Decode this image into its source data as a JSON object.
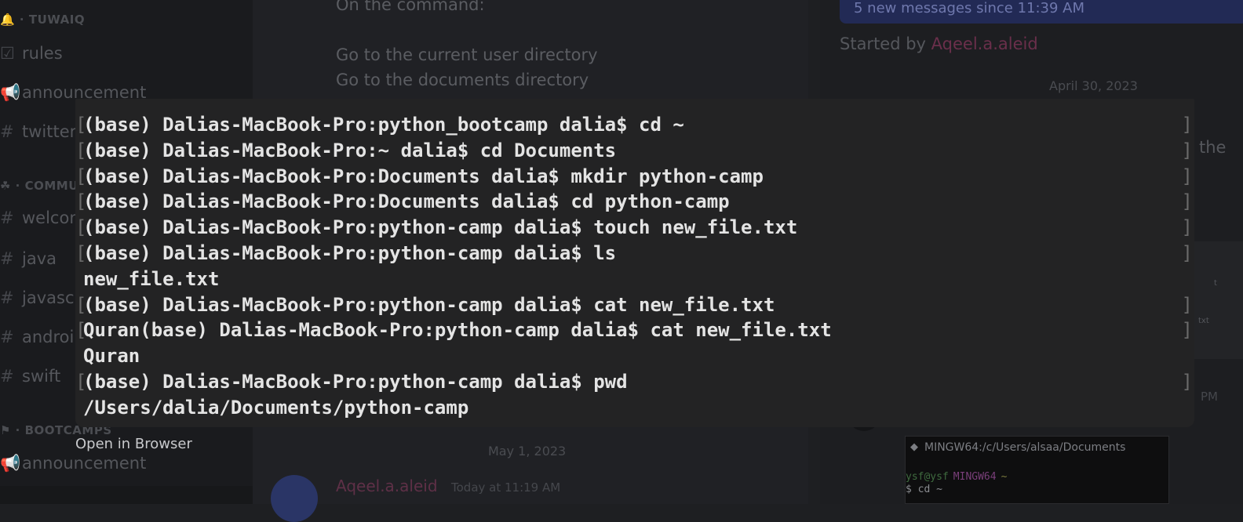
{
  "sidebar": {
    "categories": [
      {
        "label": "TUWAIQ"
      },
      {
        "label": "COMMU"
      },
      {
        "label": "BOOTCAMPS"
      }
    ],
    "items": [
      {
        "label": "rules"
      },
      {
        "label": "announcement"
      },
      {
        "label": "twitter"
      },
      {
        "label": "welcom"
      },
      {
        "label": "java"
      },
      {
        "label": "javascr"
      },
      {
        "label": "androi"
      },
      {
        "label": "swift"
      },
      {
        "label": "announcement"
      }
    ]
  },
  "chat": {
    "lines": [
      "On the command:",
      "Go to the current user directory",
      "Go to the documents directory"
    ],
    "date_separator": "May 1, 2023",
    "message": {
      "author": "Aqeel.a.aleid",
      "timestamp": "Today at 11:19 AM"
    }
  },
  "thread": {
    "new_messages_banner": "5 new messages since 11:39 AM",
    "started_by_prefix": "Started by",
    "started_by_user": "Aqeel.a.aleid",
    "date_separator": "April 30, 2023",
    "edge_text": "the",
    "time_fragment": "PM",
    "image_text_1": "txt",
    "image_text_2": "t",
    "git_window": {
      "title": "MINGW64:/c/Users/alsaa/Documents",
      "prompt_user": "ysf@ysf",
      "prompt_env": "MINGW64",
      "prompt_path": "~",
      "command": "$ cd ~"
    }
  },
  "terminal": {
    "lines": [
      {
        "text": "(base) Dalias-MacBook-Pro:python_bootcamp dalia$ cd ~",
        "bracketed": true
      },
      {
        "text": "(base) Dalias-MacBook-Pro:~ dalia$ cd Documents",
        "bracketed": true
      },
      {
        "text": "(base) Dalias-MacBook-Pro:Documents dalia$ mkdir python-camp",
        "bracketed": true
      },
      {
        "text": "(base) Dalias-MacBook-Pro:Documents dalia$ cd python-camp",
        "bracketed": true
      },
      {
        "text": "(base) Dalias-MacBook-Pro:python-camp dalia$ touch new_file.txt",
        "bracketed": true
      },
      {
        "text": "(base) Dalias-MacBook-Pro:python-camp dalia$ ls",
        "bracketed": true
      },
      {
        "text": "new_file.txt",
        "bracketed": false
      },
      {
        "text": "(base) Dalias-MacBook-Pro:python-camp dalia$ cat new_file.txt",
        "bracketed": true
      },
      {
        "text": "Quran(base) Dalias-MacBook-Pro:python-camp dalia$ cat new_file.txt",
        "bracketed": true
      },
      {
        "text": "Quran",
        "bracketed": false
      },
      {
        "text": "(base) Dalias-MacBook-Pro:python-camp dalia$ pwd",
        "bracketed": true
      },
      {
        "text": "/Users/dalia/Documents/python-camp",
        "bracketed": false
      }
    ],
    "open_in_browser_label": "Open in Browser"
  },
  "colors": {
    "terminal_background": "#232324",
    "terminal_text": "#e4e4e4",
    "app_background": "#1e1f22",
    "username_accent": "#6a2f4b",
    "banner_accent": "#222a55"
  }
}
